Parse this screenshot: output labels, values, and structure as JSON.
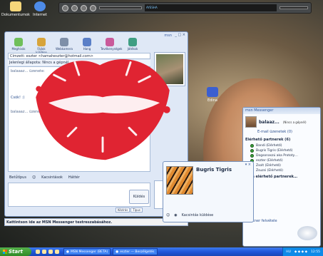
{
  "colors": {
    "lips": "#e02432",
    "xp_blue": "#2156d9",
    "msn_border": "#7793bf",
    "online": "#3aa03a"
  },
  "desktop": {
    "icons": [
      {
        "label": "Dokumentumok",
        "icon": "folder-icon"
      },
      {
        "label": "Internet",
        "icon": "ie-icon"
      },
      {
        "label": "Edina",
        "icon": "picture-icon"
      }
    ]
  },
  "media_player": {
    "display": "AYESHA"
  },
  "conversation": {
    "title": "msn",
    "controls": "_ □ ×",
    "toolbar": [
      {
        "label": "Meghívás",
        "icon": "invite-icon"
      },
      {
        "label": "Fájlok küldése",
        "icon": "send-files-icon"
      },
      {
        "label": "Webkamera",
        "icon": "webcam-icon"
      },
      {
        "label": "Hang",
        "icon": "audio-icon"
      },
      {
        "label": "Tevékenységek",
        "icon": "activities-icon"
      },
      {
        "label": "Játékok",
        "icon": "games-icon"
      }
    ],
    "to_line": "Címzett: eszter <hamaheszter@hotmail.com>",
    "status_line": "Jelenlegi állapota: Nincs a gépnél",
    "chat": [
      "balaaaz… üzenete:",
      "Csók! :)",
      "balaaaz… üzenete:"
    ],
    "format_bar": {
      "font": "Betűtípus",
      "emoticons": "Kacsintások",
      "backgrounds": "Háttér"
    },
    "send": "Küldés",
    "tabs": [
      "Kézírás",
      "Típus"
    ],
    "ad": "Kattintson ide az MSN Messenger testreszabásához."
  },
  "messenger": {
    "header": "msn Messenger",
    "user_name": "balaaz...",
    "user_status": "(Nincs a gépnél)",
    "mail": "E-mail üzenetek (0)",
    "online_group": "Elérhető partnerek (6)",
    "contacts": [
      "Bandi (Elérhető)",
      "Bugris Tigris (Elérhető)",
      "Dogsonaszú aka Prototy…",
      "eszter (Elérhető)",
      "Zsolt (Elérhető)",
      "Zsuzsi (Elérhető)"
    ],
    "offline_group": "Nem elérhető partnerek…",
    "add_contact": "Partner felvétele"
  },
  "popup": {
    "name": "Bugris Tigris",
    "controls": "▾ ×",
    "action": "Kacsintás küldése"
  },
  "taskbar": {
    "start": "Start",
    "tasks": [
      "MSN Messenger (BETA)",
      "eszter — Beszélgetés"
    ],
    "tray_lang": "HU",
    "clock": "12:55"
  }
}
